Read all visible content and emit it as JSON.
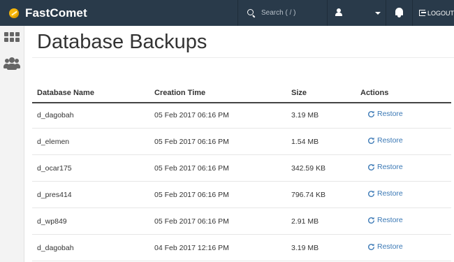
{
  "app": {
    "brand": "FastComet"
  },
  "header": {
    "search_placeholder": "Search ( / )",
    "logout_label": "LOGOUT"
  },
  "page": {
    "title": "Database Backups"
  },
  "table": {
    "columns": [
      "Database Name",
      "Creation Time",
      "Size",
      "Actions"
    ],
    "rows": [
      {
        "name": "d_dagobah",
        "created": "05 Feb 2017 06:16 PM",
        "size": "3.19 MB",
        "action": "Restore"
      },
      {
        "name": "d_elemen",
        "created": "05 Feb 2017 06:16 PM",
        "size": "1.54 MB",
        "action": "Restore"
      },
      {
        "name": "d_ocar175",
        "created": "05 Feb 2017 06:16 PM",
        "size": "342.59 KB",
        "action": "Restore"
      },
      {
        "name": "d_pres414",
        "created": "05 Feb 2017 06:16 PM",
        "size": "796.74 KB",
        "action": "Restore"
      },
      {
        "name": "d_wp849",
        "created": "05 Feb 2017 06:16 PM",
        "size": "2.91 MB",
        "action": "Restore"
      },
      {
        "name": "d_dagobah",
        "created": "04 Feb 2017 12:16 PM",
        "size": "3.19 MB",
        "action": "Restore"
      }
    ]
  },
  "icons": {
    "logo": "fastcomet-logo-icon",
    "search": "search-icon",
    "user": "user-icon",
    "bell": "bell-icon",
    "logout": "sign-out-icon",
    "apps": "grid-icon",
    "users": "users-icon",
    "restore": "refresh-icon"
  },
  "colors": {
    "topbar": "#293a4a",
    "accent": "#f5b50a",
    "link": "#3a78b5"
  }
}
